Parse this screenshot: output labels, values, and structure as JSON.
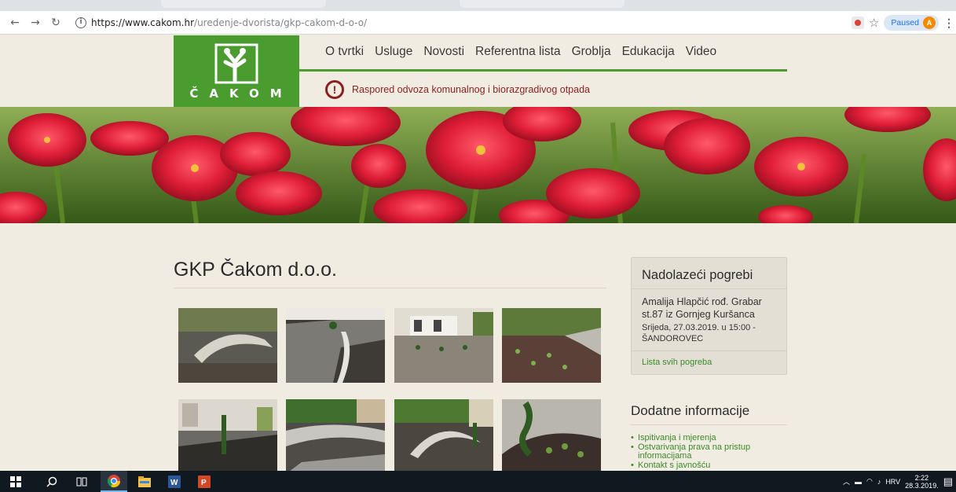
{
  "browser": {
    "url_host": "https://www.cakom.hr",
    "url_path": "/uredenje-dvorista/gkp-cakom-d-o-o/",
    "paused_label": "Paused",
    "profile_initial": "A",
    "back_icon": "arrow-left-icon",
    "forward_icon": "arrow-right-icon",
    "reload_icon": "reload-icon",
    "info_icon": "info-icon",
    "star_icon": "star-icon"
  },
  "site": {
    "logo_text": "ČAKOM",
    "nav": [
      "O tvrtki",
      "Usluge",
      "Novosti",
      "Referentna lista",
      "Groblja",
      "Edukacija",
      "Video"
    ],
    "notice_text": "Raspored odvoza komunalnog i biorazgradivog otpada",
    "notice_icon": "!"
  },
  "main": {
    "title": "GKP Čakom d.o.o."
  },
  "sidebar": {
    "funerals_title": "Nadolazeći pogrebi",
    "funeral_name": "Amalija Hlapčić rođ. Grabar st.87 iz Gornjeg Kuršanca",
    "funeral_when": "Srijeda, 27.03.2019. u 15:00 - ŠANDOROVEC",
    "funerals_link": "Lista svih pogreba",
    "info_title": "Dodatne informacije",
    "info_links": [
      "Ispitivanja i mjerenja",
      "Ostvarivanja prava na pristup informacijama",
      "Kontakt s javnošću"
    ]
  },
  "taskbar": {
    "language": "HRV",
    "time": "2:22",
    "date": "28.3.2019."
  },
  "colors": {
    "brand_green": "#4a9c2f",
    "notice_red": "#8a1f1f",
    "page_bg": "#f1ece1",
    "link_green": "#3a8a2a"
  }
}
